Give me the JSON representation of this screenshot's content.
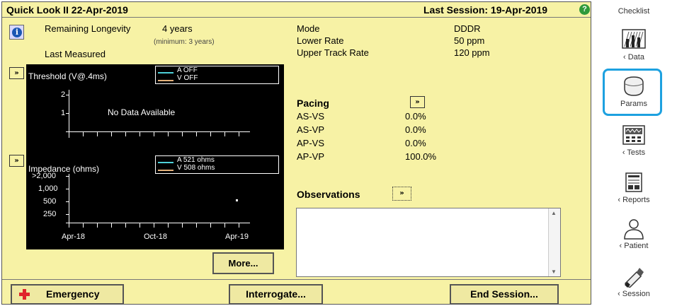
{
  "header": {
    "title": "Quick Look II  22-Apr-2019",
    "last_session": "Last Session: 19-Apr-2019",
    "help_icon": "help-circle-icon"
  },
  "longevity": {
    "label": "Remaining Longevity",
    "value": "4 years",
    "minimum": "(minimum: 3 years)",
    "last_measured": "Last Measured",
    "info_icon": "info-icon"
  },
  "settings": {
    "rows": [
      {
        "label": "Mode",
        "value": "DDDR"
      },
      {
        "label": "Lower Rate",
        "value": "50 ppm"
      },
      {
        "label": "Upper Track Rate",
        "value": "120 ppm"
      }
    ]
  },
  "threshold_chart": {
    "title": "Threshold (V@.4ms)",
    "legend": {
      "a": "A  OFF",
      "v": "V  OFF"
    },
    "y_ticks": [
      "2",
      "1"
    ],
    "empty_message": "No Data Available",
    "expand_label": "»"
  },
  "impedance_chart": {
    "title": "Impedance (ohms)",
    "legend": {
      "a": "A  521 ohms",
      "v": "V  508 ohms"
    },
    "y_ticks": [
      ">2,000",
      "1,000",
      "500",
      "250"
    ],
    "x_ticks": [
      "Apr-18",
      "Oct-18",
      "Apr-19"
    ],
    "expand_label": "»"
  },
  "chart_data": [
    {
      "type": "scatter",
      "title": "Threshold (V@.4ms)",
      "ylabel": "",
      "yticks": [
        "1",
        "2"
      ],
      "series": [
        {
          "name": "A",
          "status": "OFF",
          "points": []
        },
        {
          "name": "V",
          "status": "OFF",
          "points": []
        }
      ],
      "annotation": "No Data Available"
    },
    {
      "type": "scatter",
      "title": "Impedance (ohms)",
      "ylabel": "",
      "yticks": [
        "250",
        "500",
        "1,000",
        ">2,000"
      ],
      "xticks": [
        "Apr-18",
        "Oct-18",
        "Apr-19"
      ],
      "series": [
        {
          "name": "A",
          "value": "521 ohms",
          "points": [
            {
              "x": "Apr-19",
              "y": 521
            }
          ]
        },
        {
          "name": "V",
          "value": "508 ohms",
          "points": []
        }
      ]
    }
  ],
  "pacing": {
    "title": "Pacing",
    "expand_label": "»",
    "rows": [
      {
        "label": "AS-VS",
        "value": "0.0%"
      },
      {
        "label": "AS-VP",
        "value": "0.0%"
      },
      {
        "label": "AP-VS",
        "value": "0.0%"
      },
      {
        "label": "AP-VP",
        "value": "100.0%"
      }
    ]
  },
  "observations": {
    "title": "Observations",
    "expand_label": "»",
    "text": ""
  },
  "buttons": {
    "more": "More...",
    "emergency": "Emergency",
    "interrogate": "Interrogate...",
    "end_session": "End Session..."
  },
  "sidebar": {
    "items": [
      {
        "label": "Checklist",
        "icon": "checklist-icon"
      },
      {
        "label": "‹ Data",
        "icon": "data-icon"
      },
      {
        "label": "Params",
        "icon": "params-icon"
      },
      {
        "label": "‹ Tests",
        "icon": "tests-icon"
      },
      {
        "label": "‹ Reports",
        "icon": "reports-icon"
      },
      {
        "label": "‹ Patient",
        "icon": "patient-icon"
      },
      {
        "label": "‹ Session",
        "icon": "session-icon"
      }
    ]
  },
  "colors": {
    "background": "#f7f2a5",
    "chart_background": "#000000",
    "series_a": "#4fd0d8",
    "series_v": "#e4b27a",
    "highlight": "#1da1e0",
    "emergency": "#e0252b",
    "help": "#2f9a3a"
  }
}
